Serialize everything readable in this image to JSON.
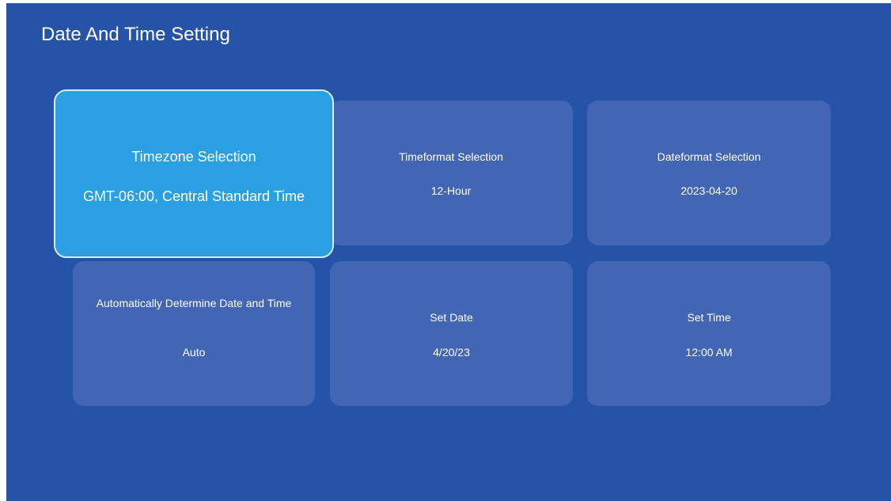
{
  "page": {
    "title": "Date And Time Setting"
  },
  "colors": {
    "background": "#2453a8",
    "tile": "#4266b4",
    "tile_focused": "#2aa0e2",
    "text": "#ffffff"
  },
  "tiles": [
    {
      "label": "Timezone Selection",
      "value": "GMT-06:00, Central Standard Time",
      "focused": true
    },
    {
      "label": "Timeformat Selection",
      "value": "12-Hour",
      "focused": false
    },
    {
      "label": "Dateformat Selection",
      "value": "2023-04-20",
      "focused": false
    },
    {
      "label": "Automatically Determine Date and Time",
      "value": "Auto",
      "focused": false
    },
    {
      "label": "Set Date",
      "value": "4/20/23",
      "focused": false
    },
    {
      "label": "Set Time",
      "value": "12:00 AM",
      "focused": false
    }
  ]
}
